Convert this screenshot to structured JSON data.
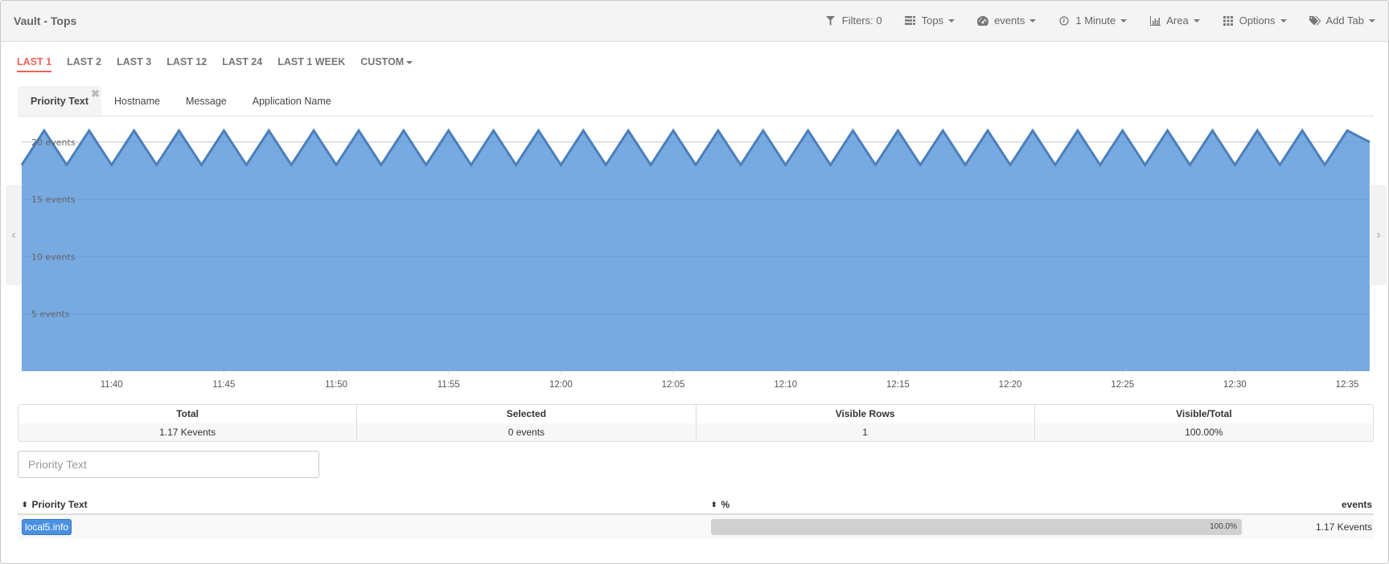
{
  "app": {
    "title": "Vault - Tops"
  },
  "toolbar": {
    "items": [
      {
        "label": "Filters: 0",
        "icon": "filter-icon",
        "dropdown": false
      },
      {
        "label": "Tops",
        "icon": "list-icon",
        "dropdown": true
      },
      {
        "label": "events",
        "icon": "dashboard-icon",
        "dropdown": true
      },
      {
        "label": "1 Minute",
        "icon": "clock-icon",
        "dropdown": true
      },
      {
        "label": "Area",
        "icon": "bar-chart-icon",
        "dropdown": true
      },
      {
        "label": "Options",
        "icon": "grid-icon",
        "dropdown": true
      },
      {
        "label": "Add Tab",
        "icon": "tag-icon",
        "dropdown": true
      }
    ]
  },
  "time_tabs": {
    "items": [
      "LAST 1",
      "LAST 2",
      "LAST 3",
      "LAST 12",
      "LAST 24",
      "LAST 1 WEEK",
      "CUSTOM"
    ],
    "active": "LAST 1"
  },
  "field_tabs": {
    "items": [
      "Priority Text",
      "Hostname",
      "Message",
      "Application Name"
    ],
    "active": "Priority Text",
    "close_glyph": "✖"
  },
  "chart_data": {
    "type": "area",
    "title": "",
    "xlabel": "",
    "ylabel": "",
    "ylim": [
      0,
      22
    ],
    "y_ticks": [
      5,
      10,
      15,
      20
    ],
    "y_tick_labels": [
      "5 events",
      "10 events",
      "15 events",
      "20 events"
    ],
    "x_tick_labels": [
      "11:40",
      "11:45",
      "11:50",
      "11:55",
      "12:00",
      "12:05",
      "12:10",
      "12:15",
      "12:20",
      "12:25",
      "12:30",
      "12:35"
    ],
    "x_start": "11:36",
    "x_end": "12:36",
    "x_step_minutes": 1,
    "series": [
      {
        "name": "local5.info",
        "color": "#78aae2",
        "line_color": "#4a7fbb",
        "values": [
          18,
          21,
          18,
          21,
          18,
          21,
          18,
          21,
          18,
          21,
          18,
          21,
          18,
          21,
          18,
          21,
          18,
          21,
          18,
          21,
          18,
          21,
          18,
          21,
          18,
          21,
          18,
          21,
          18,
          21,
          18,
          21,
          18,
          21,
          18,
          21,
          18,
          21,
          18,
          21,
          18,
          21,
          18,
          21,
          18,
          21,
          18,
          21,
          18,
          21,
          18,
          21,
          18,
          21,
          18,
          21,
          18,
          21,
          18,
          21,
          20
        ]
      }
    ],
    "grid": true,
    "legend": "none"
  },
  "chart_nav": {
    "prev_glyph": "‹",
    "next_glyph": "›"
  },
  "stats": [
    {
      "label": "Total",
      "value": "1.17 Kevents"
    },
    {
      "label": "Selected",
      "value": "0 events"
    },
    {
      "label": "Visible Rows",
      "value": "1"
    },
    {
      "label": "Visible/Total",
      "value": "100.00%"
    }
  ],
  "filter": {
    "placeholder": "Priority Text",
    "value": ""
  },
  "table": {
    "columns": [
      "Priority Text",
      "%",
      "events"
    ],
    "sort_glyph": "⬍",
    "rows": [
      {
        "name": "local5.info",
        "percent": 100.0,
        "percent_label": "100.0%",
        "events": "1.17 Kevents"
      }
    ]
  }
}
